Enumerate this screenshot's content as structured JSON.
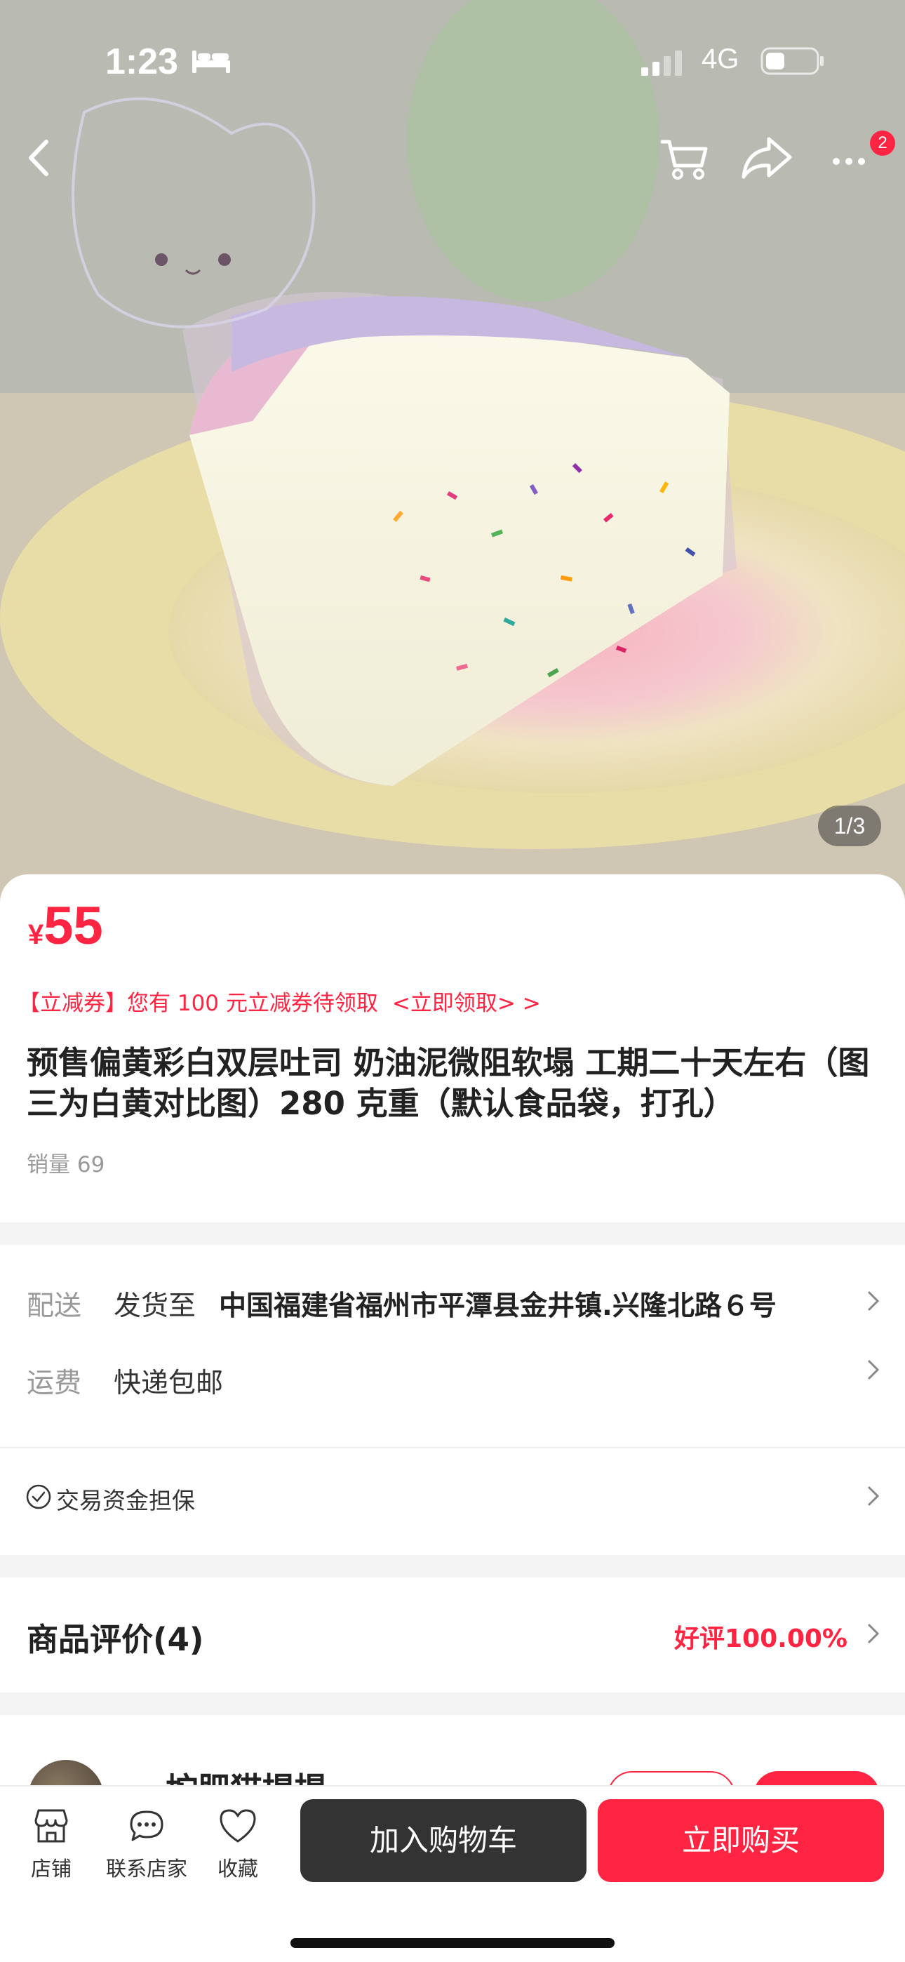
{
  "status_bar": {
    "time": "1:23",
    "network": "4G",
    "sleep_icon": "bed-icon"
  },
  "nav": {
    "more_badge": "2"
  },
  "gallery": {
    "pager": "1/3"
  },
  "product": {
    "currency": "¥",
    "price": "55",
    "coupon_text": "【立减券】您有 100 元立减券待领取",
    "coupon_link": "<立即领取> >",
    "title": "预售偏黄彩白双层吐司  奶油泥微阻软塌  工期二十天左右（图三为白黄对比图）280 克重（默认食品袋，打孔）",
    "sales": "销量 69"
  },
  "delivery": {
    "ship_label": "配送",
    "ship_to_label": "发货至",
    "address": "中国福建省福州市平潭县金井镇.兴隆北路６号",
    "fee_label": "运费",
    "fee_value": "快递包邮",
    "guarantee": "交易资金担保"
  },
  "reviews": {
    "title": "商品评价(4)",
    "rating": "好评100.00%"
  },
  "shop": {
    "name": "一坨肥猫提提"
  },
  "bottom_bar": {
    "tabs": [
      {
        "label": "店铺",
        "icon": "store-icon"
      },
      {
        "label": "联系店家",
        "icon": "chat-icon"
      },
      {
        "label": "收藏",
        "icon": "heart-icon"
      }
    ],
    "add_to_cart": "加入购物车",
    "buy_now": "立即购买"
  },
  "colors": {
    "accent": "#ff2442",
    "dark_button": "#333333"
  }
}
